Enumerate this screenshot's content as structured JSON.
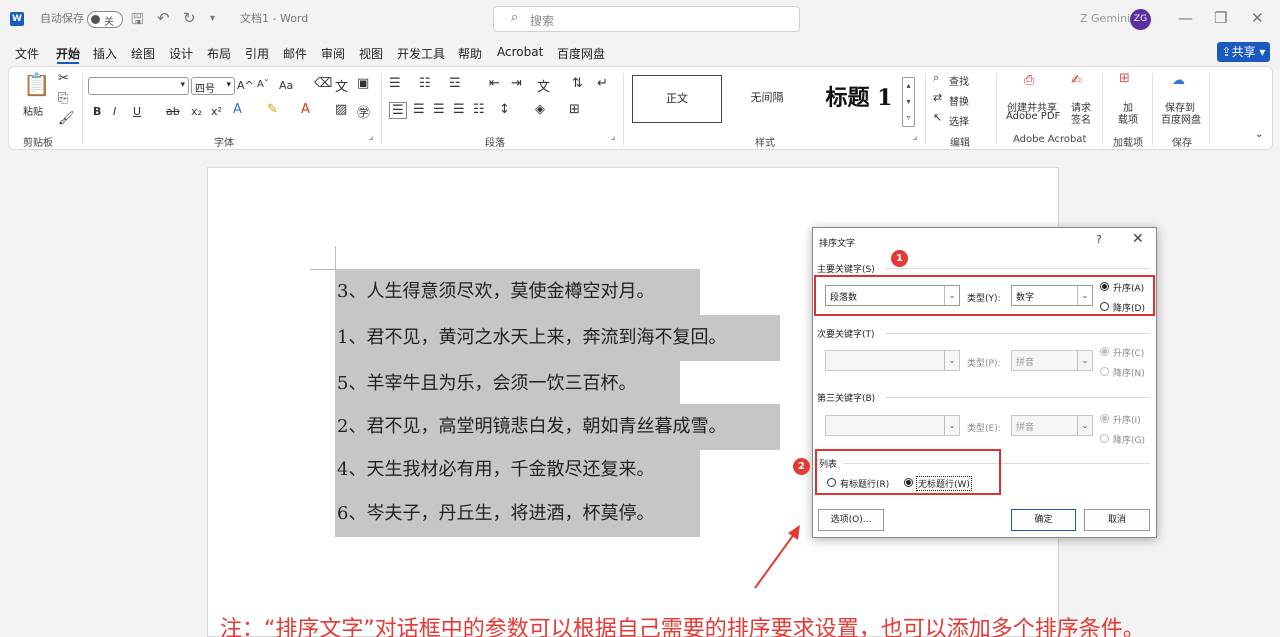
{
  "titlebar": {
    "autosave_label": "自动保存",
    "toggle_state": "关",
    "doc_title": "文档1 - Word",
    "search_placeholder": "搜索",
    "user_name": "Z Gemini",
    "user_initials": "ZG"
  },
  "menu": {
    "items": [
      "文件",
      "开始",
      "插入",
      "绘图",
      "设计",
      "布局",
      "引用",
      "邮件",
      "审阅",
      "视图",
      "开发工具",
      "帮助",
      "Acrobat",
      "百度网盘"
    ],
    "share": "共享"
  },
  "ribbon": {
    "clipboard": {
      "paste": "粘贴",
      "label": "剪贴板"
    },
    "font": {
      "size": "四号",
      "label": "字体",
      "grow": "A^",
      "shrink": "Aˇ",
      "case": "Aa",
      "bold": "B",
      "italic": "I",
      "underline": "U",
      "strike": "ab",
      "sub": "x₂",
      "sup": "x²"
    },
    "paragraph": {
      "label": "段落"
    },
    "styles": {
      "normal": "正文",
      "no_spacing": "无间隔",
      "heading1": "标题 1",
      "label": "样式"
    },
    "editing": {
      "find": "查找",
      "replace": "替换",
      "select": "选择",
      "label": "编辑"
    },
    "acrobat": {
      "create_share_1": "创建并共享",
      "create_share_2": "Adobe PDF",
      "request_1": "请求",
      "request_2": "签名",
      "label": "Adobe Acrobat"
    },
    "addins": {
      "btn_1": "加",
      "btn_2": "载项",
      "label": "加载项"
    },
    "save": {
      "btn_1": "保存到",
      "btn_2": "百度网盘",
      "label": "保存"
    }
  },
  "document": {
    "lines": [
      "3、人生得意须尽欢，莫使金樽空对月。",
      "1、君不见，黄河之水天上来，奔流到海不复回。",
      "5、羊宰牛且为乐，会须一饮三百杯。",
      "2、君不见，高堂明镜悲白发，朝如青丝暮成雪。",
      "4、天生我材必有用，千金散尽还复来。",
      "6、岑夫子，丹丘生，将进酒，杯莫停。"
    ]
  },
  "dialog": {
    "title": "排序文字",
    "help": "?",
    "primary_key_label": "主要关键字(S)",
    "primary_key_value": "段落数",
    "type_label_primary": "类型(Y):",
    "type_value_primary": "数字",
    "asc_label_primary": "升序(A)",
    "desc_label_primary": "降序(D)",
    "secondary_key_label": "次要关键字(T)",
    "type_label_secondary": "类型(P):",
    "type_value_secondary": "拼音",
    "asc_label_secondary": "升序(C)",
    "desc_label_secondary": "降序(N)",
    "third_key_label": "第三关键字(B)",
    "type_label_third": "类型(E):",
    "type_value_third": "拼音",
    "asc_label_third": "升序(I)",
    "desc_label_third": "降序(G)",
    "list_label": "列表",
    "has_header": "有标题行(R)",
    "no_header": "无标题行(W)",
    "options_btn": "选项(O)...",
    "ok_btn": "确定",
    "cancel_btn": "取消"
  },
  "annotations": {
    "badge1": "1",
    "badge2": "2",
    "note": "注：“排序文字”对话框中的参数可以根据自己需要的排序要求设置，也可以添加多个排序条件。"
  }
}
